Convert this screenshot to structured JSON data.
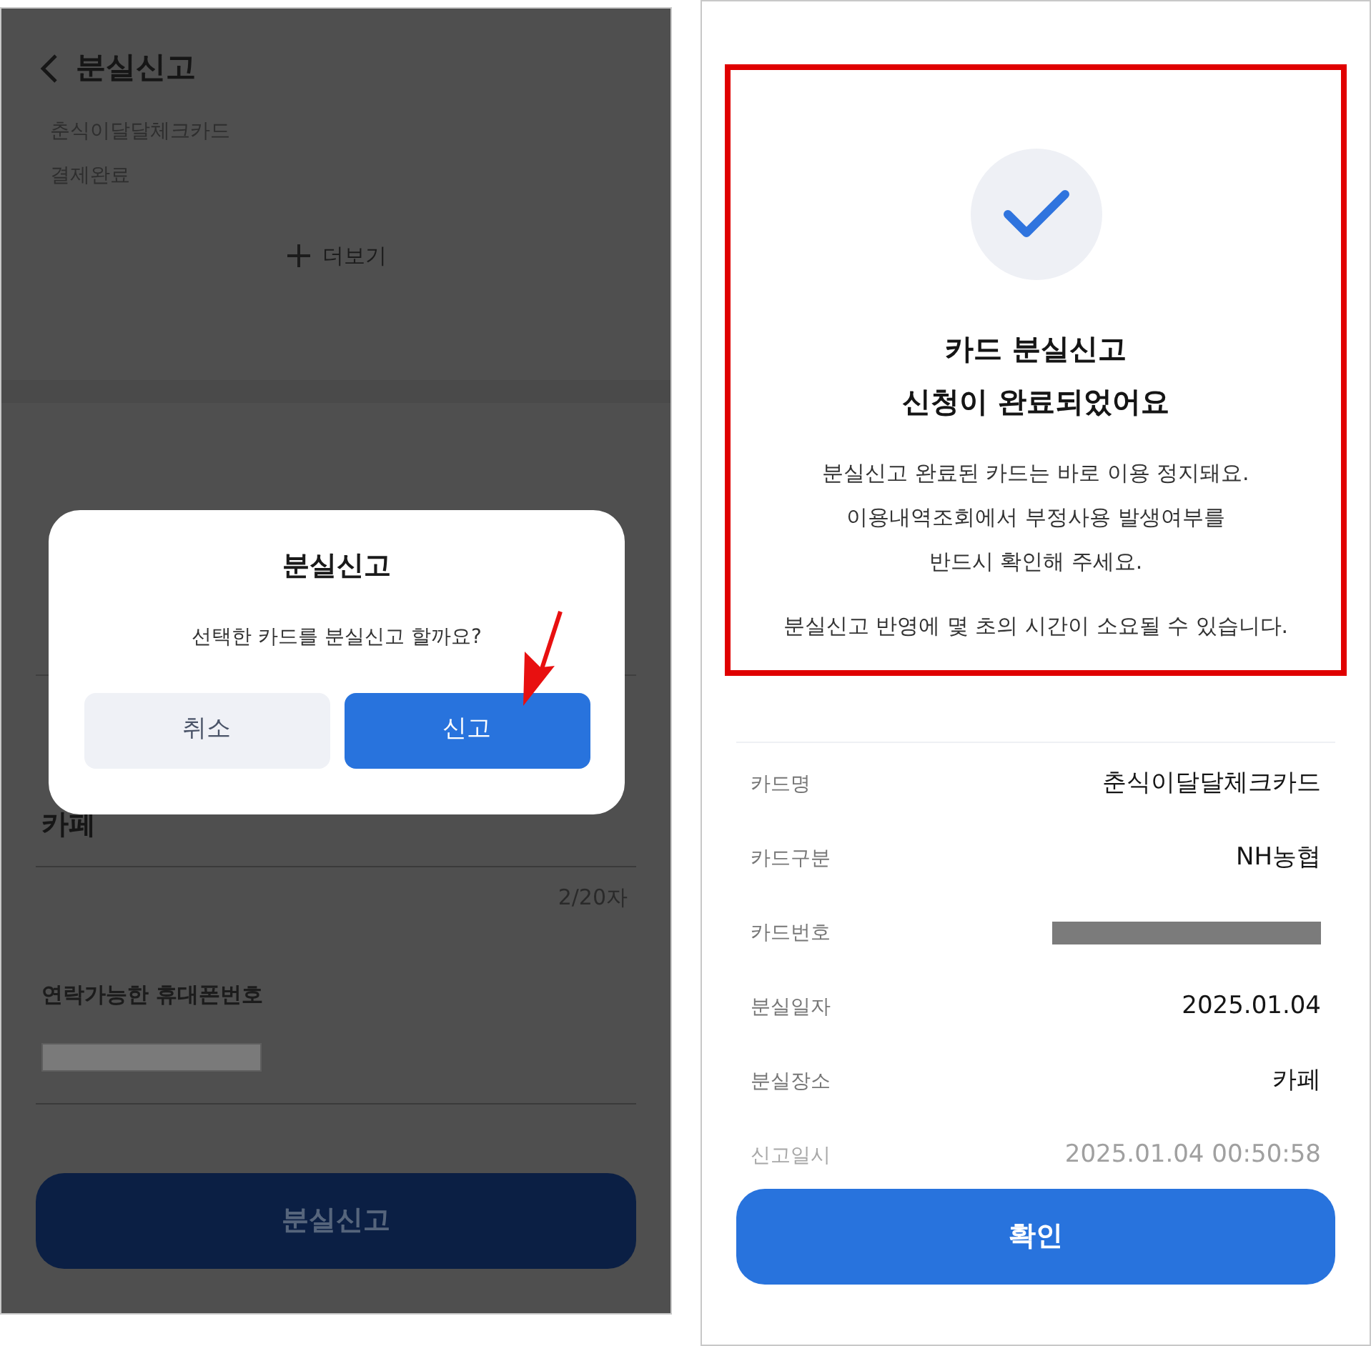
{
  "left_screen": {
    "header": {
      "title": "분실신고"
    },
    "card_name": "춘식이달달체크카드",
    "payment_status": "결제완료",
    "more_button": "더보기",
    "place_value": "카페",
    "char_count": "2/20자",
    "phone_label": "연락가능한 휴대폰번호",
    "submit_button": "분실신고",
    "dialog": {
      "title": "분실신고",
      "message": "선택한 카드를 분실신고 할까요?",
      "buttons": [
        {
          "label": "취소",
          "kind": "secondary"
        },
        {
          "label": "신고",
          "kind": "primary"
        }
      ]
    }
  },
  "right_screen": {
    "title_lines": [
      "카드 분실신고",
      "신청이 완료되었어요"
    ],
    "description_lines": [
      "분실신고 완료된 카드는 바로 이용 정지돼요.",
      "이용내역조회에서 부정사용 발생여부를",
      "반드시 확인해 주세요."
    ],
    "note": "분실신고 반영에 몇 초의 시간이 소요될 수 있습니다.",
    "details": [
      {
        "label": "카드명",
        "kind": "text",
        "value": "춘식이달달체크카드",
        "dimmed": false
      },
      {
        "label": "카드구분",
        "kind": "text",
        "value": "NH농협",
        "dimmed": false
      },
      {
        "label": "카드번호",
        "kind": "redacted",
        "dimmed": false
      },
      {
        "label": "분실일자",
        "kind": "text",
        "value": "2025.01.04",
        "dimmed": false
      },
      {
        "label": "분실장소",
        "kind": "text",
        "value": "카페",
        "dimmed": false
      },
      {
        "label": "신고일시",
        "kind": "text",
        "value": "2025.01.04 00:50:58",
        "dimmed": true
      }
    ],
    "confirm_button": "확인"
  }
}
